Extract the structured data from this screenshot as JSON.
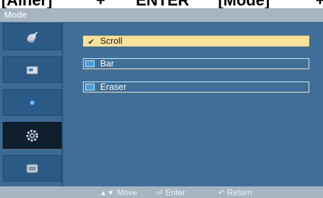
{
  "caption": {
    "parts": [
      "[Ainer]",
      "+",
      "ENTER",
      "[Mode]",
      "+"
    ]
  },
  "window": {
    "title": "Mode"
  },
  "sidebar": {
    "items": [
      {
        "icon": "satellite-dish-icon"
      },
      {
        "icon": "picture-icon"
      },
      {
        "icon": "sound-icon"
      },
      {
        "icon": "setup-gear-icon",
        "selected": true
      },
      {
        "icon": "input-source-icon"
      }
    ]
  },
  "menu": {
    "items": [
      {
        "label": "Scroll",
        "selected": true
      },
      {
        "label": "Bar",
        "selected": false
      },
      {
        "label": "Eraser",
        "selected": false
      }
    ]
  },
  "footer": {
    "move": "Move",
    "enter": "Enter",
    "return": "Return"
  },
  "colors": {
    "panel": "#3f6f98",
    "header": "#a7b4c2",
    "highlight": "#fbe19a",
    "sidebar_selected": "#0f1f2e"
  }
}
